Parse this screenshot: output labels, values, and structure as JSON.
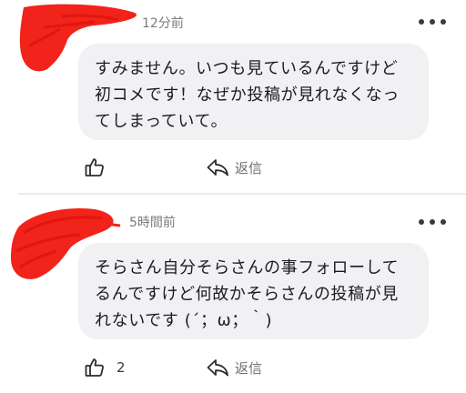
{
  "comments": [
    {
      "timestamp": "12分前",
      "body": "すみません。いつも見ているんですけど初コメです！なぜか投稿が見れなくなってしまっていて。",
      "like_count": "",
      "reply_label": "返信"
    },
    {
      "timestamp": "5時間前",
      "body": "そらさん自分そらさんの事フォローしてるんですけど何故かそらさんの投稿が見れないです (´；ω；｀)",
      "like_count": "2",
      "reply_label": "返信"
    }
  ],
  "colors": {
    "bubble": "#f1f1f3",
    "scribble": "#f2231a",
    "timestamp": "#7a7a80",
    "divider": "#ececee"
  },
  "icons": {
    "like": "thumbs-up-icon",
    "reply": "reply-arrow-icon",
    "more": "more-horizontal-icon",
    "avatar": "redacted-avatar-scribble"
  }
}
